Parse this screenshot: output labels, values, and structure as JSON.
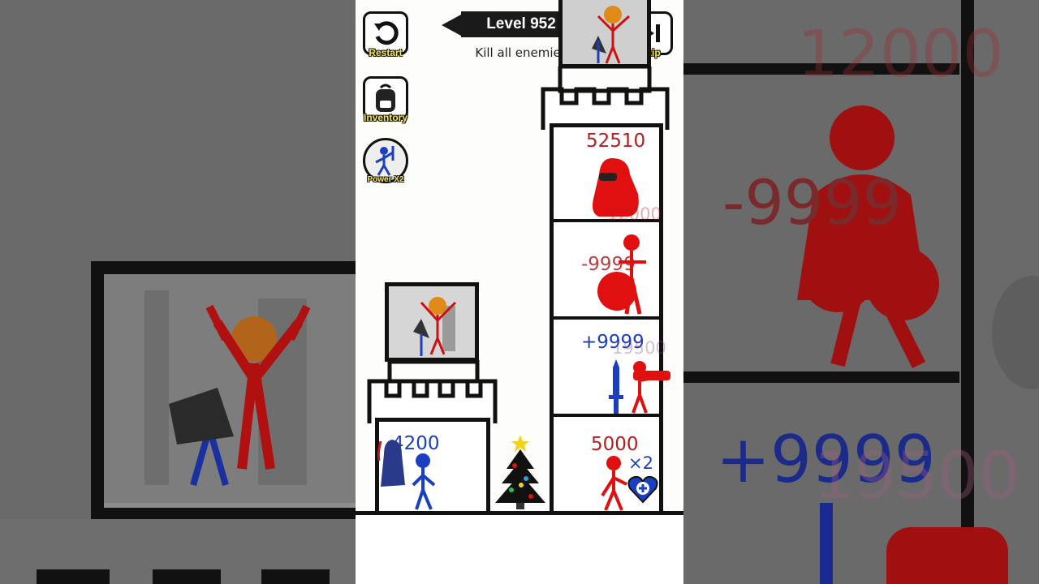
{
  "level": {
    "label": "Level 952",
    "objective": "Kill all enemies"
  },
  "buttons": {
    "restart": "Restart",
    "inventory": "Inventory",
    "power": "Power X2",
    "skip": "Skip"
  },
  "player_tower": {
    "hero_power": "4200"
  },
  "enemy_tower": {
    "floors": [
      {
        "value": "52510",
        "overlay": "12000"
      },
      {
        "value": "-9999"
      },
      {
        "value": "+9999",
        "overlay": "19500"
      },
      {
        "value": "5000",
        "multiplier": "×2"
      }
    ]
  },
  "zoomed_background": {
    "numbers": [
      "12000",
      "-9999",
      "+9999",
      "19500"
    ]
  },
  "colors": {
    "enemy": "#d01010",
    "hero": "#1a3fc0",
    "ui_label": "#f5e642"
  }
}
